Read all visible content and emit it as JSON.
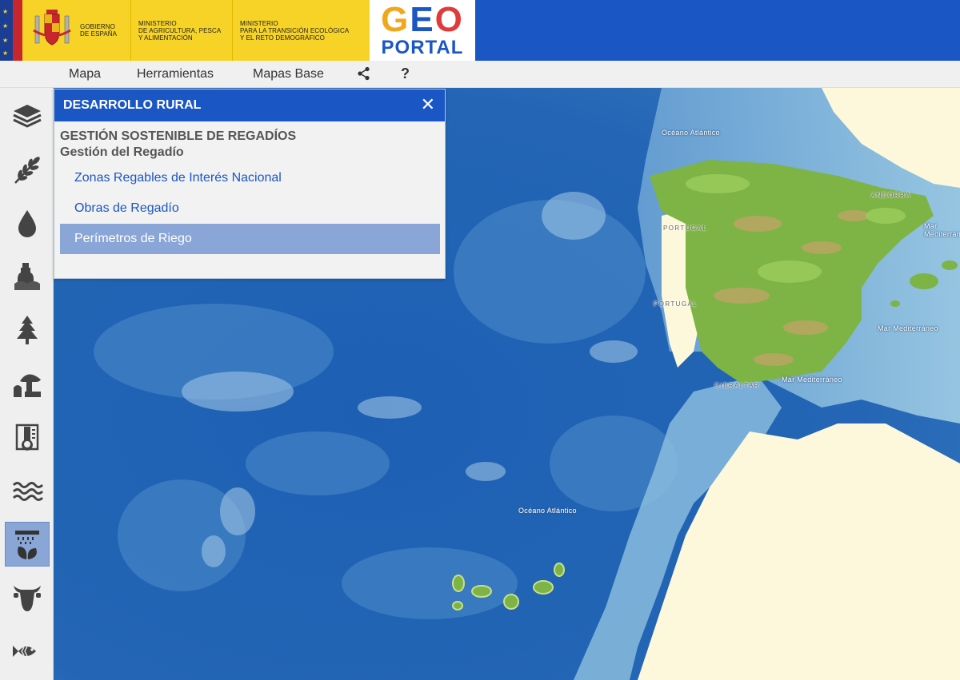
{
  "header": {
    "gov_line1": "Gobierno",
    "gov_line2": "de España",
    "min1_line1": "Ministerio",
    "min1_line2": "de Agricultura, Pesca",
    "min1_line3": "y Alimentación",
    "min2_line1": "Ministerio",
    "min2_line2": "para la Transición Ecológica",
    "min2_line3": "y el Reto Demográfico",
    "logo_top": "GEO",
    "logo_bottom": "PORTAL",
    "brand_color": "#1a56c4"
  },
  "nav": {
    "mapa": "Mapa",
    "herramientas": "Herramientas",
    "mapas_base": "Mapas Base",
    "share_icon": "share-icon",
    "help_label": "?"
  },
  "sidebar": {
    "items": [
      {
        "icon": "layers-icon"
      },
      {
        "icon": "wheat-icon"
      },
      {
        "icon": "water-drop-icon"
      },
      {
        "icon": "food-jug-icon"
      },
      {
        "icon": "tree-icon"
      },
      {
        "icon": "mushroom-icon"
      },
      {
        "icon": "thermometer-icon"
      },
      {
        "icon": "waves-icon"
      },
      {
        "icon": "irrigation-icon",
        "active": true
      },
      {
        "icon": "cow-icon"
      },
      {
        "icon": "fish-icon"
      }
    ]
  },
  "panel": {
    "title": "DESARROLLO RURAL",
    "close_label": "✕",
    "section": "GESTIÓN SOSTENIBLE DE REGADÍOS",
    "subsection": "Gestión del Regadío",
    "links": [
      {
        "label": "Zonas Regables de Interés Nacional",
        "selected": false
      },
      {
        "label": "Obras de Regadío",
        "selected": false
      },
      {
        "label": "Perímetros de Riego",
        "selected": true
      }
    ]
  },
  "map": {
    "labels": {
      "oceano_atlantico_north": "Océano Atlántico",
      "oceano_atlantico_south": "Océano Atlántico",
      "portugal_1": "PORTUGAL",
      "portugal_2": "PORTUGAL",
      "andorra": "ANDORRA",
      "mar_med_1": "Mar Mediterráneo",
      "mar_med_2": "Mar Mediterráneo",
      "mar_med_3": "Mar Mediterráneo",
      "gibraltar": "GIBRALTAR"
    }
  }
}
